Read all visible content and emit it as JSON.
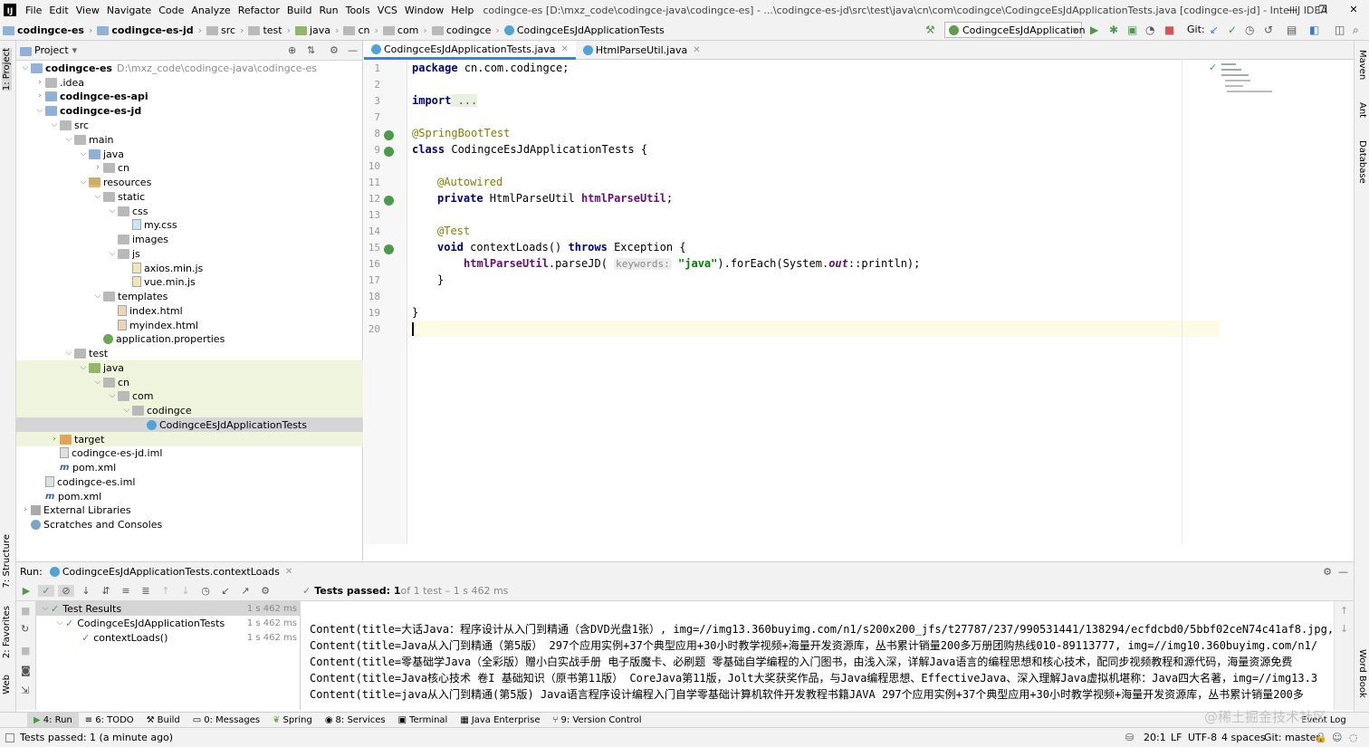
{
  "menu": {
    "items": [
      "File",
      "Edit",
      "View",
      "Navigate",
      "Code",
      "Analyze",
      "Refactor",
      "Build",
      "Run",
      "Tools",
      "VCS",
      "Window",
      "Help"
    ],
    "window_title": "codingce-es [D:\\mxz_code\\codingce-java\\codingce-es] - ...\\codingce-es-jd\\src\\test\\java\\cn\\com\\codingce\\CodingceEsJdApplicationTests.java [codingce-es-jd] - IntelliJ IDEA"
  },
  "breadcrumbs": [
    "codingce-es",
    "codingce-es-jd",
    "src",
    "test",
    "java",
    "cn",
    "com",
    "codingce",
    "CodingceEsJdApplicationTests"
  ],
  "toolbar": {
    "run_config": "CodingceEsJdApplication",
    "git_label": "Git:"
  },
  "left_strip": {
    "project": "1: Project",
    "structure": "7: Structure",
    "favorites": "2: Favorites",
    "web": "Web"
  },
  "right_strip": {
    "maven": "Maven",
    "ant": "Ant",
    "database": "Database",
    "wordbook": "Word Book"
  },
  "project_panel": {
    "title": "Project",
    "tree": [
      {
        "label": "codingce-es",
        "extra": "D:\\mxz_code\\codingce-java\\codingce-es",
        "bold": true
      },
      {
        "label": ".idea"
      },
      {
        "label": "codingce-es-api",
        "bold": true
      },
      {
        "label": "codingce-es-jd",
        "bold": true
      },
      {
        "label": "src"
      },
      {
        "label": "main"
      },
      {
        "label": "java"
      },
      {
        "label": "cn"
      },
      {
        "label": "resources"
      },
      {
        "label": "static"
      },
      {
        "label": "css"
      },
      {
        "label": "my.css"
      },
      {
        "label": "images"
      },
      {
        "label": "js"
      },
      {
        "label": "axios.min.js"
      },
      {
        "label": "vue.min.js"
      },
      {
        "label": "templates"
      },
      {
        "label": "index.html"
      },
      {
        "label": "myindex.html"
      },
      {
        "label": "application.properties"
      },
      {
        "label": "test"
      },
      {
        "label": "java"
      },
      {
        "label": "cn"
      },
      {
        "label": "com"
      },
      {
        "label": "codingce"
      },
      {
        "label": "CodingceEsJdApplicationTests"
      },
      {
        "label": "target"
      },
      {
        "label": "codingce-es-jd.iml"
      },
      {
        "label": "pom.xml"
      },
      {
        "label": "codingce-es.iml"
      },
      {
        "label": "pom.xml"
      },
      {
        "label": "External Libraries"
      },
      {
        "label": "Scratches and Consoles"
      }
    ]
  },
  "editor": {
    "tabs": [
      {
        "label": "CodingceEsJdApplicationTests.java"
      },
      {
        "label": "HtmlParseUtil.java"
      }
    ],
    "line_numbers": [
      "1",
      "2",
      "3",
      "7",
      "8",
      "9",
      "10",
      "11",
      "12",
      "13",
      "14",
      "15",
      "16",
      "17",
      "18",
      "19",
      "20"
    ],
    "code": {
      "package_kw": "package",
      "package_name": " cn.com.codingce;",
      "import_kw": "import",
      "import_fold": " ...",
      "ann_springboottest": "@SpringBootTest",
      "class_kw": "class",
      "class_name": " CodingceEsJdApplicationTests {",
      "ann_autowired": "@Autowired",
      "private_kw": "private",
      "field_type": " HtmlParseUtil ",
      "field_name": "htmlParseUtil",
      "semicolon": ";",
      "ann_test": "@Test",
      "void_kw": "void",
      "method_sig": " contextLoads() ",
      "throws_kw": "throws",
      "exception": " Exception {",
      "call_field": "htmlParseUtil",
      "call_method": ".parseJD( ",
      "param_hint": "keywords:",
      "string_arg": "\"java\"",
      "call_rest_1": ").forEach(System.",
      "call_out": "out",
      "call_rest_2": "::println);",
      "close_method": "}",
      "close_class": "}"
    }
  },
  "run_panel": {
    "label": "Run:",
    "tab": "CodingceEsJdApplicationTests.contextLoads",
    "status_bold": "Tests passed: 1",
    "status_rest": " of 1 test – 1 s 462 ms",
    "tree": [
      {
        "label": "Test Results",
        "time": "1 s 462 ms"
      },
      {
        "label": "CodingceEsJdApplicationTests",
        "time": "1 s 462 ms"
      },
      {
        "label": "contextLoads()",
        "time": "1 s 462 ms"
      }
    ],
    "console": [
      "Content(title=大话Java：程序设计从入门到精通（含DVD光盘1张）, img=//img13.360buyimg.com/n1/s200x200_jfs/t27787/237/990531441/138294/ecfdcbd0/5bbf02ceN74c41af8.jpg,",
      "Content(title=Java从入门到精通（第5版） 297个应用实例+37个典型应用+30小时教学视频+海量开发资源库，丛书累计销量200多万册团购热线010-89113777, img=//img10.360buyimg.com/n1/",
      "Content(title=零基础学Java（全彩版）赠小白实战手册 电子版魔卡、必刷题 零基础自学编程的入门图书，由浅入深，详解Java语言的编程思想和核心技术，配同步视频教程和源代码，海量资源免费",
      "Content(title=Java核心技术 卷I 基础知识（原书第11版） CoreJava第11版，Jolt大奖获奖作品，与Java编程思想、EffectiveJava、深入理解Java虚拟机堪称：Java四大名著，img=//img13.3",
      "Content(title=java从入门到精通(第5版) Java语言程序设计编程入门自学零基础计算机软件开发教程书籍JAVA 297个应用实例+37个典型应用+30小时教学视频+海量开发资源库，丛书累计销量200多"
    ]
  },
  "bottom_tabs": [
    {
      "label": "4: Run"
    },
    {
      "label": "6: TODO"
    },
    {
      "label": "Build"
    },
    {
      "label": "0: Messages"
    },
    {
      "label": "Spring"
    },
    {
      "label": "8: Services"
    },
    {
      "label": "Terminal"
    },
    {
      "label": "Java Enterprise"
    },
    {
      "label": "9: Version Control"
    }
  ],
  "event_log": "Event Log",
  "status": {
    "message": "Tests passed: 1 (a minute ago)",
    "position": "20:1",
    "line_sep": "LF",
    "encoding": "UTF-8",
    "indent": "4 spaces",
    "git": "Git: master"
  },
  "watermark": "@稀土掘金技术社区"
}
